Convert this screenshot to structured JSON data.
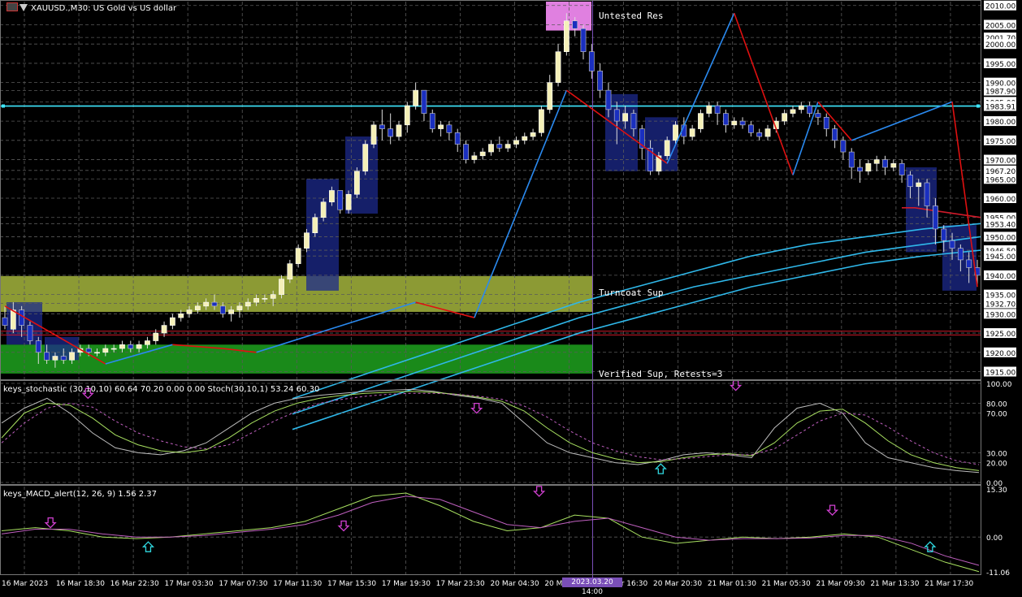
{
  "window": {
    "title": "XAUUSD.,M30: US Gold vs US dollar"
  },
  "stoch_header": "keys_stochastic (30,10,10) 60.64 70.20 0.00 0.00 Stoch(30,10,1) 53.24 60.30",
  "macd_header": "keys_MACD_alert(12, 26, 9) 1.56 2.37",
  "zones": {
    "untested_res": "Untested Res",
    "turncoat_sup": "Turncoat Sup",
    "verified_sup": "Verified Sup, Retests=3"
  },
  "time_cursor": "2023.03.20 14:00",
  "colors": {
    "bull_candle": "#f5f0b8",
    "bear_candle": "#1a2fbf",
    "zigzag_up": "#2a8af0",
    "zigzag_down": "#e01010",
    "ma": "#2fb8ea",
    "ma_red": "#d01a2a",
    "res_zone": "#e080e0",
    "turncoat_zone": "#8c9a34",
    "verified_zone": "#1a8a1a",
    "hline": "#40e8ff",
    "cursor": "#7a4fb8",
    "arrow_down": "#d040d0",
    "arrow_up": "#30d8e0"
  },
  "chart_data": [
    {
      "type": "candlestick",
      "symbol": "XAUUSD.",
      "timeframe": "M30",
      "price_axis": [
        "2010.00",
        "2005.00",
        "2001.70",
        "2000.00",
        "1995.00",
        "1990.00",
        "1987.90",
        "1985.00",
        "1983.91",
        "1980.00",
        "1975.00",
        "1970.00",
        "1967.20",
        "1965.00",
        "1960.00",
        "1955.00",
        "1953.40",
        "1950.00",
        "1946.50",
        "1945.00",
        "1940.00",
        "1935.00",
        "1932.70",
        "1930.00",
        "1925.00",
        "1920.00",
        "1915.00"
      ],
      "ylim": [
        1913,
        2011
      ],
      "time_axis": [
        "16 Mar 2023",
        "16 Mar 18:30",
        "16 Mar 22:30",
        "17 Mar 03:30",
        "17 Mar 07:30",
        "17 Mar 11:30",
        "17 Mar 15:30",
        "17 Mar 19:30",
        "17 Mar 23:30",
        "20 Mar 04:30",
        "20 Mar 08:30",
        "20 Mar 16:30",
        "20 Mar 20:30",
        "21 Mar 01:30",
        "21 Mar 05:30",
        "21 Mar 09:30",
        "21 Mar 13:30",
        "21 Mar 17:30"
      ],
      "candles": [
        [
          1929,
          1932,
          1927,
          1926
        ],
        [
          1926,
          1933,
          1931,
          1925
        ],
        [
          1931,
          1932,
          1927,
          1924
        ],
        [
          1927,
          1928,
          1923,
          1922
        ],
        [
          1923,
          1924,
          1920,
          1917
        ],
        [
          1920,
          1922,
          1918,
          1917
        ],
        [
          1918,
          1920,
          1919,
          1916
        ],
        [
          1919,
          1921,
          1918,
          1917
        ],
        [
          1918,
          1921,
          1920,
          1917
        ],
        [
          1920,
          1922,
          1921,
          1919
        ],
        [
          1921,
          1922,
          1920,
          1919
        ],
        [
          1920,
          1921,
          1920,
          1919
        ],
        [
          1920,
          1922,
          1921,
          1919
        ],
        [
          1921,
          1922,
          1921,
          1920
        ],
        [
          1921,
          1923,
          1922,
          1920
        ],
        [
          1922,
          1923,
          1921,
          1920
        ],
        [
          1921,
          1923,
          1922,
          1920
        ],
        [
          1922,
          1924,
          1923,
          1921
        ],
        [
          1923,
          1926,
          1925,
          1922
        ],
        [
          1925,
          1928,
          1927,
          1924
        ],
        [
          1927,
          1930,
          1929,
          1926
        ],
        [
          1929,
          1931,
          1930,
          1928
        ],
        [
          1930,
          1932,
          1931,
          1929
        ],
        [
          1931,
          1933,
          1932,
          1930
        ],
        [
          1932,
          1934,
          1933,
          1931
        ],
        [
          1933,
          1935,
          1932,
          1931
        ],
        [
          1932,
          1933,
          1930,
          1929
        ],
        [
          1930,
          1932,
          1931,
          1928
        ],
        [
          1931,
          1933,
          1932,
          1929
        ],
        [
          1932,
          1934,
          1933,
          1931
        ],
        [
          1933,
          1935,
          1934,
          1932
        ],
        [
          1934,
          1935,
          1934,
          1933
        ],
        [
          1934,
          1936,
          1935,
          1932
        ],
        [
          1935,
          1940,
          1939,
          1934
        ],
        [
          1939,
          1944,
          1943,
          1938
        ],
        [
          1943,
          1948,
          1947,
          1942
        ],
        [
          1947,
          1952,
          1951,
          1946
        ],
        [
          1951,
          1956,
          1955,
          1950
        ],
        [
          1955,
          1960,
          1959,
          1954
        ],
        [
          1959,
          1963,
          1962,
          1958
        ],
        [
          1962,
          1960,
          1957,
          1956
        ],
        [
          1957,
          1962,
          1961,
          1956
        ],
        [
          1961,
          1968,
          1967,
          1960
        ],
        [
          1967,
          1975,
          1974,
          1966
        ],
        [
          1974,
          1980,
          1979,
          1973
        ],
        [
          1979,
          1983,
          1978,
          1975
        ],
        [
          1978,
          1982,
          1976,
          1974
        ],
        [
          1976,
          1980,
          1979,
          1975
        ],
        [
          1979,
          1985,
          1984,
          1977
        ],
        [
          1984,
          1990,
          1988,
          1983
        ],
        [
          1988,
          1986,
          1982,
          1980
        ],
        [
          1982,
          1983,
          1978,
          1977
        ],
        [
          1978,
          1980,
          1979,
          1976
        ],
        [
          1979,
          1980,
          1977,
          1975
        ],
        [
          1977,
          1978,
          1974,
          1972
        ],
        [
          1974,
          1975,
          1970,
          1969
        ],
        [
          1970,
          1972,
          1971,
          1969
        ],
        [
          1971,
          1973,
          1972,
          1970
        ],
        [
          1972,
          1975,
          1974,
          1971
        ],
        [
          1974,
          1976,
          1973,
          1972
        ],
        [
          1973,
          1975,
          1974,
          1972
        ],
        [
          1974,
          1976,
          1975,
          1973
        ],
        [
          1975,
          1977,
          1976,
          1974
        ],
        [
          1976,
          1978,
          1977,
          1975
        ],
        [
          1977,
          1984,
          1983,
          1976
        ],
        [
          1983,
          1992,
          1990,
          1982
        ],
        [
          1990,
          2000,
          1998,
          1989
        ],
        [
          1998,
          2008,
          2006,
          1997
        ],
        [
          2006,
          2007,
          2004,
          2002
        ],
        [
          2004,
          2005,
          1998,
          1996
        ],
        [
          1998,
          2000,
          1993,
          1991
        ],
        [
          1993,
          1995,
          1988,
          1986
        ],
        [
          1988,
          1990,
          1983,
          1981
        ],
        [
          1983,
          1985,
          1980,
          1974
        ],
        [
          1980,
          1984,
          1982,
          1978
        ],
        [
          1982,
          1983,
          1978,
          1976
        ],
        [
          1978,
          1979,
          1973,
          1970
        ],
        [
          1973,
          1975,
          1967,
          1966
        ],
        [
          1967,
          1972,
          1971,
          1966
        ],
        [
          1971,
          1976,
          1975,
          1970
        ],
        [
          1975,
          1980,
          1979,
          1974
        ],
        [
          1979,
          1981,
          1976,
          1974
        ],
        [
          1976,
          1979,
          1978,
          1975
        ],
        [
          1978,
          1983,
          1982,
          1977
        ],
        [
          1982,
          1985,
          1984,
          1981
        ],
        [
          1984,
          1985,
          1982,
          1979
        ],
        [
          1982,
          1983,
          1979,
          1977
        ],
        [
          1979,
          1981,
          1980,
          1978
        ],
        [
          1980,
          1981,
          1979,
          1978
        ],
        [
          1979,
          1980,
          1977,
          1976
        ],
        [
          1977,
          1978,
          1976,
          1975
        ],
        [
          1976,
          1979,
          1978,
          1975
        ],
        [
          1978,
          1981,
          1980,
          1977
        ],
        [
          1980,
          1983,
          1982,
          1979
        ],
        [
          1982,
          1984,
          1983,
          1981
        ],
        [
          1983,
          1985,
          1984,
          1982
        ],
        [
          1984,
          1985,
          1982,
          1981
        ],
        [
          1982,
          1983,
          1981,
          1979
        ],
        [
          1981,
          1982,
          1978,
          1976
        ],
        [
          1978,
          1979,
          1975,
          1973
        ],
        [
          1975,
          1976,
          1972,
          1970
        ],
        [
          1972,
          1973,
          1968,
          1965
        ],
        [
          1968,
          1970,
          1967,
          1964
        ],
        [
          1967,
          1970,
          1969,
          1966
        ],
        [
          1969,
          1971,
          1970,
          1967
        ],
        [
          1970,
          1971,
          1968,
          1966
        ],
        [
          1968,
          1970,
          1969,
          1967
        ],
        [
          1969,
          1970,
          1966,
          1964
        ],
        [
          1966,
          1967,
          1963,
          1960
        ],
        [
          1963,
          1965,
          1964,
          1958
        ],
        [
          1964,
          1965,
          1958,
          1955
        ],
        [
          1958,
          1960,
          1952,
          1948
        ],
        [
          1952,
          1953,
          1949,
          1946
        ],
        [
          1949,
          1951,
          1947,
          1944
        ],
        [
          1947,
          1948,
          1944,
          1941
        ],
        [
          1944,
          1946,
          1942,
          1938
        ],
        [
          1942,
          1944,
          1940,
          1937
        ]
      ],
      "moving_averages": [
        {
          "color": "#2fb8ea",
          "values": [
            1908,
            1913,
            1918,
            1923,
            1928,
            1933,
            1937,
            1941,
            1945,
            1948,
            1950,
            1952,
            1953.4
          ]
        },
        {
          "color": "#2fb8ea",
          "values": [
            1904,
            1909,
            1914,
            1919,
            1924,
            1929,
            1933,
            1937,
            1940,
            1943,
            1946,
            1948,
            1950
          ]
        },
        {
          "color": "#2fb8ea",
          "values": [
            1900,
            1905,
            1910,
            1915,
            1920,
            1925,
            1929,
            1933,
            1937,
            1940,
            1943,
            1945,
            1946.5
          ]
        },
        {
          "color": "#d01a2a",
          "values": [
            1957.5,
            1957.5,
            1957,
            1956.5,
            1956,
            1955.5,
            1955
          ]
        }
      ],
      "horizontal_lines": [
        1983.91,
        1925.5,
        1924.5
      ],
      "zones": [
        {
          "name": "Untested Res",
          "from": 2003.5,
          "to": 2011
        },
        {
          "name": "Turncoat Sup",
          "from": 1930.5,
          "to": 1939.8
        },
        {
          "name": "Verified Sup, Retests=3",
          "from": 1914.5,
          "to": 1922
        }
      ],
      "zigzag": [
        1932,
        1917,
        1922,
        1921,
        1920,
        1933,
        1929,
        1988,
        1969,
        2008,
        1966,
        1985,
        1975,
        1985,
        1937
      ]
    },
    {
      "type": "line",
      "name": "keys_stochastic",
      "ylim": [
        0,
        100
      ],
      "yticks": [
        "100.00",
        "80.00",
        "70.00",
        "30.00",
        "20.00",
        "0.00"
      ],
      "series": [
        {
          "values": [
            60,
            75,
            85,
            70,
            50,
            35,
            30,
            28,
            32,
            40,
            55,
            70,
            80,
            85,
            88,
            90,
            92,
            93,
            94,
            92,
            88,
            85,
            80,
            60,
            40,
            30,
            25,
            20,
            18,
            22,
            28,
            30,
            28,
            25,
            55,
            75,
            80,
            70,
            40,
            25,
            20,
            15,
            12,
            10
          ]
        },
        {
          "values": [
            45,
            70,
            80,
            78,
            65,
            48,
            38,
            32,
            30,
            33,
            45,
            60,
            72,
            80,
            85,
            88,
            90,
            91,
            92,
            91,
            89,
            86,
            82,
            72,
            55,
            40,
            30,
            24,
            20,
            21,
            25,
            28,
            29,
            27,
            40,
            60,
            72,
            74,
            60,
            42,
            28,
            20,
            15,
            12
          ]
        },
        {
          "values": [
            40,
            60,
            75,
            80,
            76,
            62,
            50,
            42,
            36,
            34,
            38,
            50,
            62,
            72,
            80,
            84,
            87,
            89,
            90,
            90,
            89,
            87,
            84,
            77,
            66,
            52,
            40,
            32,
            26,
            23,
            24,
            26,
            28,
            28,
            34,
            48,
            62,
            70,
            68,
            56,
            42,
            30,
            22,
            18
          ]
        }
      ],
      "arrows_down": [
        2,
        11,
        17,
        24
      ],
      "arrows_up": [
        29
      ]
    },
    {
      "type": "line",
      "name": "keys_MACD_alert",
      "ylim": [
        -11.06,
        15.3
      ],
      "yticks": [
        "15.30",
        "0.00",
        "-11.06"
      ],
      "series": [
        {
          "values": [
            2,
            3,
            2,
            0,
            -0.5,
            0,
            1,
            2,
            3,
            5,
            9,
            13,
            14,
            10,
            5,
            2,
            3,
            7,
            6,
            0,
            -2,
            -1,
            0,
            -0.5,
            0,
            1,
            0,
            -4,
            -8,
            -11
          ]
        },
        {
          "values": [
            1,
            2.5,
            2.5,
            1,
            0,
            0,
            0.5,
            1.5,
            2.5,
            4,
            7,
            11,
            13,
            12,
            8,
            4,
            3,
            5,
            6,
            3,
            0,
            -1,
            -0.5,
            -0.5,
            -0.3,
            0.5,
            0.5,
            -2,
            -6,
            -9
          ]
        }
      ],
      "arrows_down": [
        1,
        7,
        11,
        17,
        24
      ],
      "arrows_up": [
        3,
        19,
        22
      ]
    }
  ]
}
